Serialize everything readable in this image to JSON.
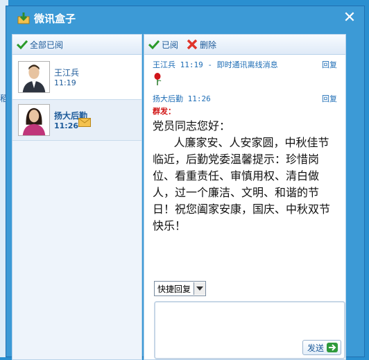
{
  "window": {
    "title": "微讯盒子"
  },
  "background": {
    "side_glyph": "稻"
  },
  "left_panel": {
    "toolbar_label": "全部已阅",
    "contacts": [
      {
        "name": "王江兵",
        "time": "11:19",
        "state": "active",
        "avatar": "male-avatar"
      },
      {
        "name": "扬大后勤",
        "time": "11:26",
        "state": "unread",
        "avatar": "female-avatar",
        "badge": "mail-icon"
      }
    ]
  },
  "right_panel": {
    "read_label": "已阅",
    "delete_label": "删除",
    "messages": [
      {
        "header": "王江兵 11:19 - 即时通讯离线消息",
        "reply": "回复",
        "attachment": "rose-icon"
      },
      {
        "header": "扬大后勤 11:26",
        "reply": "回复",
        "group_tag": "群发：",
        "body": "党员同志您好：\n      人廉家安、人安家圆，中秋佳节临近，后勤党委温馨提示：珍惜岗位、看重责任、审慎用权、清白做人，过一个廉洁、文明、和谐的节日！祝您阖家安康，国庆、中秋双节快乐！"
      }
    ],
    "quick_reply": {
      "selected": "快捷回复"
    },
    "input": {
      "value": ""
    },
    "send_label": "发送"
  },
  "colors": {
    "accent": "#3c9ad6",
    "link": "#1c6cb5",
    "alert": "#d01010"
  }
}
